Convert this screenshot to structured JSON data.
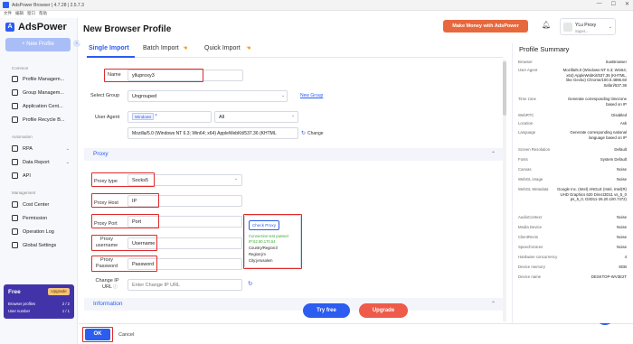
{
  "titlebar": {
    "title": "AdsPower Browser | 4.7.28 | 2.5.7.3",
    "menu": [
      "文件",
      "编辑",
      "窗口",
      "帮助"
    ],
    "controls": [
      "—",
      "☐",
      "✕"
    ]
  },
  "sidebar": {
    "logo": "AdsPower",
    "new_profile": "+ New Profile",
    "sections": {
      "common": "Common",
      "automation": "Automation",
      "management": "Management"
    },
    "common_items": [
      {
        "label": "Profile Managem...",
        "icon": "profile-icon"
      },
      {
        "label": "Group Managem...",
        "icon": "group-icon"
      },
      {
        "label": "Application Cent...",
        "icon": "app-center-icon"
      },
      {
        "label": "Profile Recycle B...",
        "icon": "recycle-icon"
      }
    ],
    "automation_items": [
      {
        "label": "RPA",
        "icon": "rpa-icon",
        "chevron": "⌄"
      },
      {
        "label": "Data Report",
        "icon": "report-icon",
        "chevron": "⌄"
      },
      {
        "label": "API",
        "icon": "api-icon"
      }
    ],
    "management_items": [
      {
        "label": "Cost Center",
        "icon": "cost-icon"
      },
      {
        "label": "Permission",
        "icon": "permission-icon"
      },
      {
        "label": "Operation Log",
        "icon": "log-icon"
      },
      {
        "label": "Global Settings",
        "icon": "settings-icon"
      }
    ],
    "plan": {
      "name": "Free",
      "upgrade": "Upgrade",
      "profiles_label": "Browser profiles",
      "profiles_value": "2 / 2",
      "users_label": "User number",
      "users_value": "1 / 1"
    }
  },
  "header": {
    "title": "New Browser Profile",
    "promo": "Make Money with AdsPower",
    "user": {
      "name": "YLu Proxy",
      "role": "Super..."
    }
  },
  "tabs": [
    "Single Import",
    "Batch Import",
    "Quick Import"
  ],
  "form": {
    "name_label": "Name",
    "name_value": "ylluproxy3",
    "group_label": "Select Group",
    "group_value": "Ungrouped",
    "new_group": "New Group",
    "ua_label": "User Agent",
    "ua_os": "Windows",
    "ua_version": "All",
    "ua_string": "Mozilla/5.0 (Windows NT 6.3; Win64; x64) AppleWebKit/537.36 (KHTML",
    "change": "Change"
  },
  "proxy": {
    "section_title": "Proxy",
    "type_label": "Proxy type",
    "type_value": "Socks5",
    "host_label": "Proxy Host",
    "host_value": "IP",
    "port_label": "Proxy Port",
    "port_value": "Port",
    "user_label": "Proxy username",
    "user_value": "Username",
    "pass_label": "Proxy Password",
    "pass_value": "Password",
    "change_ip_label": "Change IP URL",
    "change_ip_placeholder": "Enter Change IP URL",
    "check_button": "Check Proxy",
    "check_status": "Connection test passed",
    "check_ip": "IP:62.90.170.54",
    "check_country": "Country/Region:il",
    "check_region": "Region:jm",
    "check_city": "City:jerusalem"
  },
  "information": {
    "section_title": "Information"
  },
  "buttons": {
    "try_free": "Try free",
    "upgrade": "Upgrade",
    "ok": "OK",
    "cancel": "Cancel"
  },
  "summary": {
    "title": "Profile Summary",
    "rows": [
      {
        "k": "Browser",
        "v": "SunBrowser"
      },
      {
        "k": "User Agent",
        "v": "Mozilla/5.0 (Windows NT 6.3; Win64; x64) AppleWebKit/537.36 (KHTML, like Gecko) Chrome/100.0.4896.60 Safari/537.36"
      },
      {
        "k": "Time zone",
        "v": "Generate corresponding timezone based on IP"
      },
      {
        "k": "WebRTC",
        "v": "Disabled"
      },
      {
        "k": "Location",
        "v": "Ask"
      },
      {
        "k": "Language",
        "v": "Generate corresponding national language based on IP"
      },
      {
        "k": "Screen Resolution",
        "v": "Default"
      },
      {
        "k": "Fonts",
        "v": "System Default"
      },
      {
        "k": "Canvas",
        "v": "Noise"
      },
      {
        "k": "WebGL image",
        "v": "Noise"
      },
      {
        "k": "WebGL Metadata",
        "v": "Google Inc. (Intel) ANGLE (Intel, Intel(R) UHD Graphics 620 Direct3D11 vs_5_0 ps_5_0, D3D11-26.20.100.7372)"
      },
      {
        "k": "AudioContext",
        "v": "Noise"
      },
      {
        "k": "Media Device",
        "v": "Noise"
      },
      {
        "k": "ClientRects",
        "v": "Noise"
      },
      {
        "k": "SpeechVoices",
        "v": "Noise"
      },
      {
        "k": "Hardware concurrency",
        "v": "4"
      },
      {
        "k": "Device memory",
        "v": "8GB"
      },
      {
        "k": "Device name",
        "v": "DESKTOP-WV3E2T"
      }
    ]
  },
  "colors": {
    "accent": "#2c5cf0",
    "highlight": "#e02a2a",
    "promo": "#e8683e",
    "plan": "#4234a8"
  }
}
